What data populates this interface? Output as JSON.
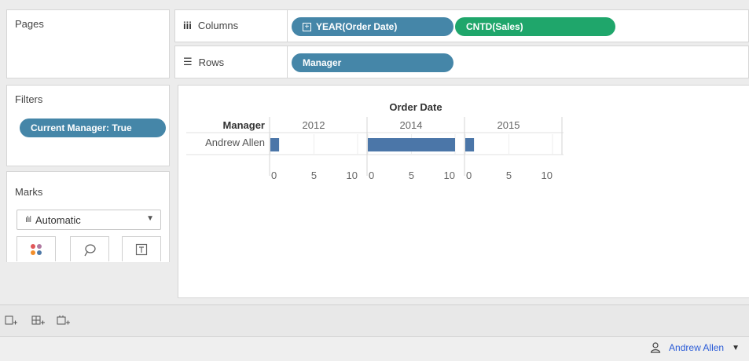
{
  "pages": {
    "title": "Pages"
  },
  "shelves": {
    "columns": {
      "label": "Columns",
      "icon": "iii",
      "pills": [
        "YEAR(Order Date)",
        "CNTD(Sales)"
      ]
    },
    "rows": {
      "label": "Rows",
      "icon": "☰",
      "pills": [
        "Manager"
      ]
    }
  },
  "filters": {
    "title": "Filters",
    "pill": "Current Manager: True"
  },
  "marks": {
    "title": "Marks",
    "type_label": "Automatic"
  },
  "colors": {
    "blue_pill": "#4586a8",
    "green_pill": "#1fa66b",
    "bar": "#4b76a8",
    "user_link": "#2a5bd7"
  },
  "chart_data": {
    "type": "bar",
    "title": "Order Date",
    "row_header": "Manager",
    "rows": [
      "Andrew Allen"
    ],
    "panes": [
      "2012",
      "2014",
      "2015"
    ],
    "series": [
      {
        "name": "CNTD(Sales)",
        "values": [
          1,
          10,
          1
        ]
      }
    ],
    "xlim": [
      0,
      10
    ],
    "ticks": [
      0,
      5,
      10
    ]
  },
  "status": {
    "user": "Andrew Allen"
  }
}
